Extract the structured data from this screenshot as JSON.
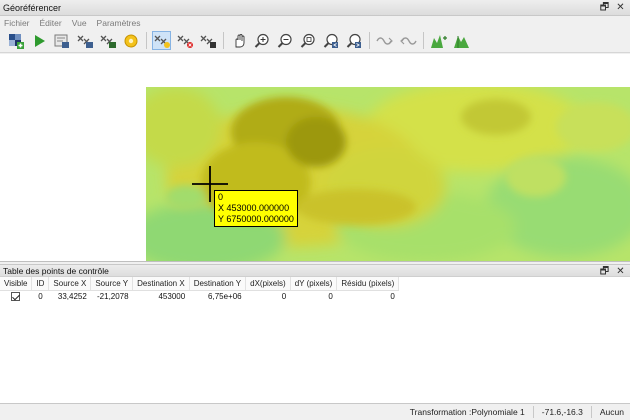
{
  "window": {
    "title": "Géoréférencer"
  },
  "menu": [
    "Fichier",
    "Éditer",
    "Vue",
    "Paramètres"
  ],
  "toolbar": {
    "icons": [
      "open-raster-icon",
      "start-georeferencing-icon",
      "generate-gdal-script-icon",
      "load-gcp-points-icon",
      "save-gcp-points-icon",
      "transformation-settings-icon",
      "add-point-icon",
      "delete-point-icon",
      "move-gcp-point-icon",
      "pan-icon",
      "zoom-in-icon",
      "zoom-out-icon",
      "zoom-to-layer-icon",
      "zoom-last-icon",
      "zoom-next-icon",
      "link-georeferencer-to-qgis-icon",
      "link-qgis-to-georeferencer-icon",
      "full-histogram-stretch-icon",
      "local-histogram-stretch-icon"
    ]
  },
  "canvas": {
    "tooltip": {
      "id": "0",
      "x_text": "X 453000.000000",
      "y_text": "Y 6750000.000000"
    }
  },
  "gcp_table": {
    "title": "Table des points de contrôle",
    "columns": [
      "Visible",
      "ID",
      "Source X",
      "Source Y",
      "Destination X",
      "Destination Y",
      "dX(pixels)",
      "dY (pixels)",
      "Résidu (pixels)"
    ],
    "rows": [
      {
        "visible": true,
        "id": "0",
        "source_x": "33,4252",
        "source_y": "-21,2078",
        "dest_x": "453000",
        "dest_y": "6,75e+06",
        "dx": "0",
        "dy": "0",
        "residual": "0"
      }
    ]
  },
  "status": {
    "transformation": "Transformation :Polynomiale 1",
    "coords": "-71.6,-16.3",
    "crs": "Aucun"
  }
}
